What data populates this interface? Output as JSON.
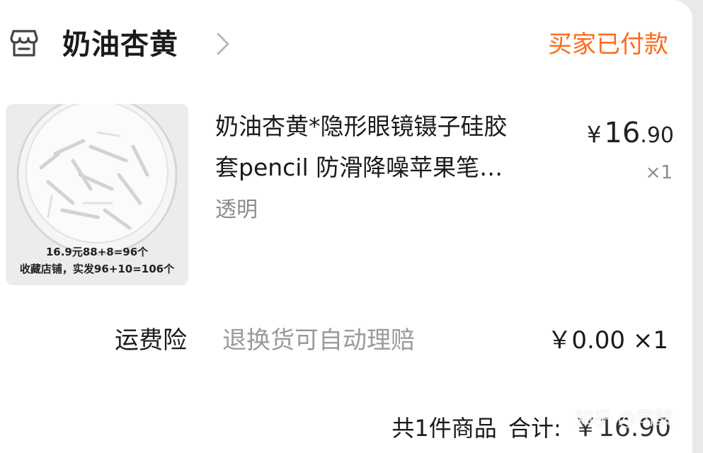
{
  "store": {
    "name": "奶油杏黄",
    "icon": "store-icon"
  },
  "order": {
    "status": "买家已付款",
    "status_color": "#ff6a1a"
  },
  "product": {
    "title_line1": "奶油杏黄*隐形眼镜镊子硅胶",
    "title_line2": "套pencil 防滑降噪苹果笔…",
    "sku": "透明",
    "price_symbol": "¥",
    "price_int": "16",
    "price_dec": ".90",
    "quantity": "×1",
    "image_caption_line1": "16.9元88+8=96个",
    "image_caption_line2": "收藏店铺，实发96+10=106个"
  },
  "shipping_insurance": {
    "label": "运费险",
    "description": "退换货可自动理赔",
    "price": "￥0.00 ×1"
  },
  "footer": {
    "item_count": "共1件商品",
    "total_label": "合计:",
    "total_value": "￥16.90"
  },
  "watermark": "知乎 @司酸"
}
